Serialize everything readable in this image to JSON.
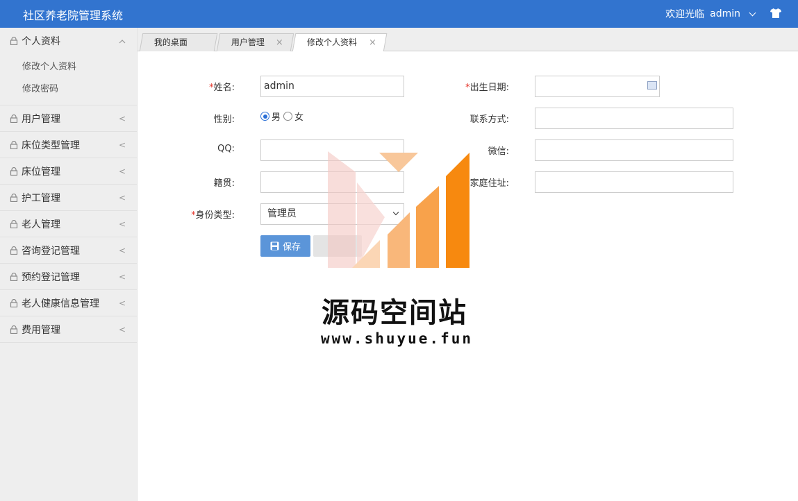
{
  "header": {
    "title": "社区养老院管理系统",
    "welcome": "欢迎光临",
    "username": "admin",
    "icons": [
      "chevron-down-icon",
      "shirt-icon"
    ]
  },
  "sidebar": {
    "groups": [
      {
        "label": "个人资料",
        "expanded": true,
        "children": [
          "修改个人资料",
          "修改密码"
        ]
      },
      {
        "label": "用户管理",
        "expanded": false
      },
      {
        "label": "床位类型管理",
        "expanded": false
      },
      {
        "label": "床位管理",
        "expanded": false
      },
      {
        "label": "护工管理",
        "expanded": false
      },
      {
        "label": "老人管理",
        "expanded": false
      },
      {
        "label": "咨询登记管理",
        "expanded": false
      },
      {
        "label": "预约登记管理",
        "expanded": false
      },
      {
        "label": "老人健康信息管理",
        "expanded": false
      },
      {
        "label": "费用管理",
        "expanded": false
      }
    ],
    "arrow_collapsed": "<",
    "arrow_expanded": "^"
  },
  "tabs": [
    {
      "label": "我的桌面",
      "closable": false,
      "active": false
    },
    {
      "label": "用户管理",
      "closable": true,
      "active": false
    },
    {
      "label": "修改个人资料",
      "closable": true,
      "active": true
    }
  ],
  "tab_close_glyph": "×",
  "form": {
    "required_mark": "*",
    "name_label": "姓名:",
    "name_value": "admin",
    "birth_label": "出生日期:",
    "birth_value": "",
    "gender_label": "性别:",
    "gender_options": [
      "男",
      "女"
    ],
    "gender_selected": "男",
    "contact_label": "联系方式:",
    "contact_value": "",
    "qq_label": "QQ:",
    "qq_value": "",
    "wechat_label": "微信:",
    "wechat_value": "",
    "native_label": "籍贯:",
    "native_value": "",
    "address_label": "家庭住址:",
    "address_value": "",
    "identity_label": "身份类型:",
    "identity_value": "管理员",
    "save_label": "保存"
  },
  "watermark": {
    "title": "源码空间站",
    "url": "www.shuyue.fun"
  },
  "colors": {
    "header_bg": "#3274cf",
    "save_button": "#5b95d9",
    "required": "#e5342a",
    "watermark_orange": "#f7890f"
  }
}
